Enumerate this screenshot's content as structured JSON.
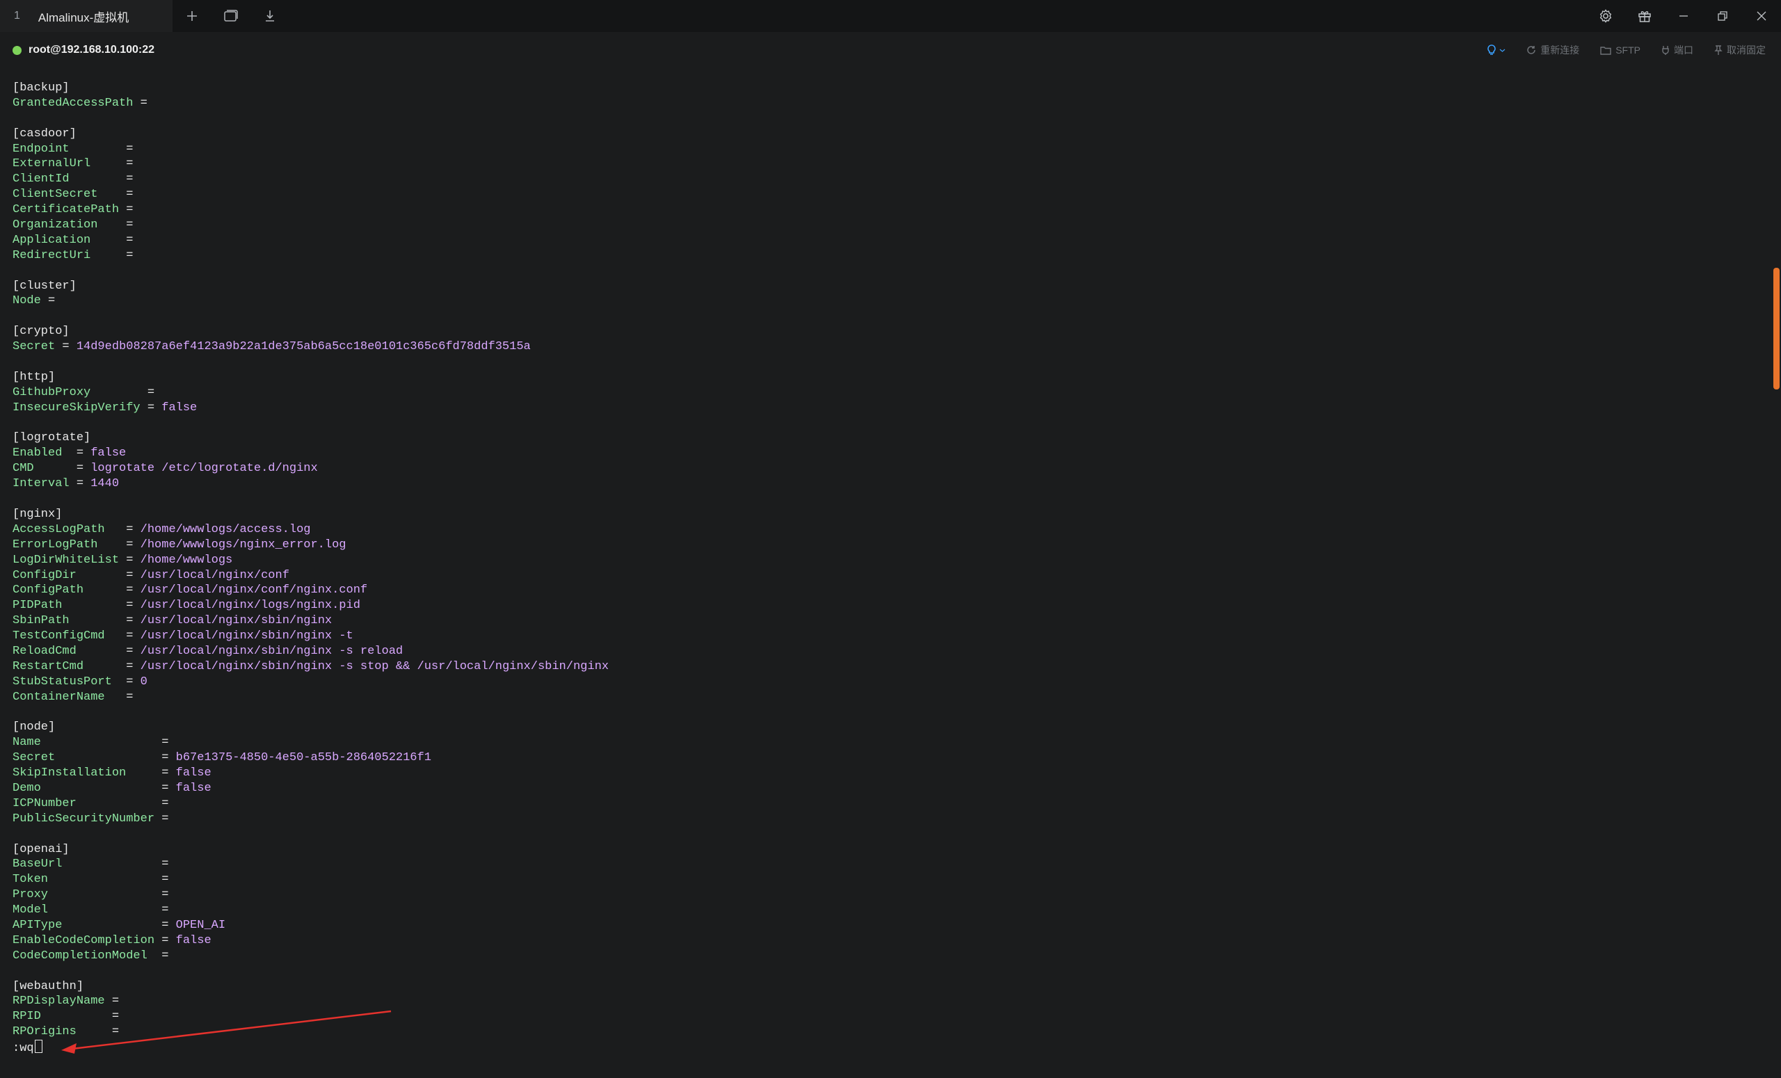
{
  "tab": {
    "index": "1",
    "title": "Almalinux-虚拟机"
  },
  "session": {
    "host": "root@192.168.10.100:22",
    "status_color": "#7ed35a",
    "actions": {
      "reconnect": "重新连接",
      "sftp": "SFTP",
      "port": "端口",
      "unpin": "取消固定"
    }
  },
  "icons": {
    "new_tab": "plus-icon",
    "clone_tab": "window-copy-icon",
    "download": "download-icon",
    "settings": "gear-icon",
    "gift": "gift-icon",
    "minimize": "minimize-icon",
    "restore": "restore-icon",
    "close": "close-icon",
    "bulb": "lightbulb-icon"
  },
  "colors": {
    "key": "#8fe7a2",
    "value": "#d9a8ff",
    "scroll_thumb": "#e9742b",
    "annotation_arrow": "#e5322d"
  },
  "terminal": {
    "lines": [
      {
        "t": "sec",
        "text": "[backup]"
      },
      {
        "t": "kv",
        "key": "GrantedAccessPath",
        "eq": " =",
        "val": ""
      },
      {
        "t": "blank"
      },
      {
        "t": "sec",
        "text": "[casdoor]"
      },
      {
        "t": "kv",
        "key": "Endpoint",
        "eq": "        =",
        "val": ""
      },
      {
        "t": "kv",
        "key": "ExternalUrl",
        "eq": "     =",
        "val": ""
      },
      {
        "t": "kv",
        "key": "ClientId",
        "eq": "        =",
        "val": ""
      },
      {
        "t": "kv",
        "key": "ClientSecret",
        "eq": "    =",
        "val": ""
      },
      {
        "t": "kv",
        "key": "CertificatePath",
        "eq": " =",
        "val": ""
      },
      {
        "t": "kv",
        "key": "Organization",
        "eq": "    =",
        "val": ""
      },
      {
        "t": "kv",
        "key": "Application",
        "eq": "     =",
        "val": ""
      },
      {
        "t": "kv",
        "key": "RedirectUri",
        "eq": "     =",
        "val": ""
      },
      {
        "t": "blank"
      },
      {
        "t": "sec",
        "text": "[cluster]"
      },
      {
        "t": "kv",
        "key": "Node",
        "eq": " =",
        "val": ""
      },
      {
        "t": "blank"
      },
      {
        "t": "sec",
        "text": "[crypto]"
      },
      {
        "t": "kv",
        "key": "Secret",
        "eq": " = ",
        "val": "14d9edb08287a6ef4123a9b22a1de375ab6a5cc18e0101c365c6fd78ddf3515a"
      },
      {
        "t": "blank"
      },
      {
        "t": "sec",
        "text": "[http]"
      },
      {
        "t": "kv",
        "key": "GithubProxy",
        "eq": "        =",
        "val": ""
      },
      {
        "t": "kv",
        "key": "InsecureSkipVerify",
        "eq": " = ",
        "val": "false"
      },
      {
        "t": "blank"
      },
      {
        "t": "sec",
        "text": "[logrotate]"
      },
      {
        "t": "kv",
        "key": "Enabled",
        "eq": "  = ",
        "val": "false"
      },
      {
        "t": "kv",
        "key": "CMD",
        "eq": "      = ",
        "val": "logrotate /etc/logrotate.d/nginx"
      },
      {
        "t": "kv",
        "key": "Interval",
        "eq": " = ",
        "val": "1440"
      },
      {
        "t": "blank"
      },
      {
        "t": "sec",
        "text": "[nginx]"
      },
      {
        "t": "kv",
        "key": "AccessLogPath",
        "eq": "   = ",
        "val": "/home/wwwlogs/access.log"
      },
      {
        "t": "kv",
        "key": "ErrorLogPath",
        "eq": "    = ",
        "val": "/home/wwwlogs/nginx_error.log"
      },
      {
        "t": "kv",
        "key": "LogDirWhiteList",
        "eq": " = ",
        "val": "/home/wwwlogs"
      },
      {
        "t": "kv",
        "key": "ConfigDir",
        "eq": "       = ",
        "val": "/usr/local/nginx/conf"
      },
      {
        "t": "kv",
        "key": "ConfigPath",
        "eq": "      = ",
        "val": "/usr/local/nginx/conf/nginx.conf"
      },
      {
        "t": "kv",
        "key": "PIDPath",
        "eq": "         = ",
        "val": "/usr/local/nginx/logs/nginx.pid"
      },
      {
        "t": "kv",
        "key": "SbinPath",
        "eq": "        = ",
        "val": "/usr/local/nginx/sbin/nginx"
      },
      {
        "t": "kv",
        "key": "TestConfigCmd",
        "eq": "   = ",
        "val": "/usr/local/nginx/sbin/nginx -t"
      },
      {
        "t": "kv",
        "key": "ReloadCmd",
        "eq": "       = ",
        "val": "/usr/local/nginx/sbin/nginx -s reload"
      },
      {
        "t": "kv",
        "key": "RestartCmd",
        "eq": "      = ",
        "val": "/usr/local/nginx/sbin/nginx -s stop && /usr/local/nginx/sbin/nginx"
      },
      {
        "t": "kv",
        "key": "StubStatusPort",
        "eq": "  = ",
        "val": "0"
      },
      {
        "t": "kv",
        "key": "ContainerName",
        "eq": "   =",
        "val": ""
      },
      {
        "t": "blank"
      },
      {
        "t": "sec",
        "text": "[node]"
      },
      {
        "t": "kv",
        "key": "Name",
        "eq": "                 =",
        "val": ""
      },
      {
        "t": "kv",
        "key": "Secret",
        "eq": "               = ",
        "val": "b67e1375-4850-4e50-a55b-2864052216f1"
      },
      {
        "t": "kv",
        "key": "SkipInstallation",
        "eq": "     = ",
        "val": "false"
      },
      {
        "t": "kv",
        "key": "Demo",
        "eq": "                 = ",
        "val": "false"
      },
      {
        "t": "kv",
        "key": "ICPNumber",
        "eq": "            =",
        "val": ""
      },
      {
        "t": "kv",
        "key": "PublicSecurityNumber",
        "eq": " =",
        "val": ""
      },
      {
        "t": "blank"
      },
      {
        "t": "sec",
        "text": "[openai]"
      },
      {
        "t": "kv",
        "key": "BaseUrl",
        "eq": "              =",
        "val": ""
      },
      {
        "t": "kv",
        "key": "Token",
        "eq": "                =",
        "val": ""
      },
      {
        "t": "kv",
        "key": "Proxy",
        "eq": "                =",
        "val": ""
      },
      {
        "t": "kv",
        "key": "Model",
        "eq": "                =",
        "val": ""
      },
      {
        "t": "kv",
        "key": "APIType",
        "eq": "              = ",
        "val": "OPEN_AI"
      },
      {
        "t": "kv",
        "key": "EnableCodeCompletion",
        "eq": " = ",
        "val": "false"
      },
      {
        "t": "kv",
        "key": "CodeCompletionModel",
        "eq": "  =",
        "val": ""
      },
      {
        "t": "blank"
      },
      {
        "t": "sec",
        "text": "[webauthn]"
      },
      {
        "t": "kv",
        "key": "RPDisplayName",
        "eq": " =",
        "val": ""
      },
      {
        "t": "kv",
        "key": "RPID",
        "eq": "          =",
        "val": ""
      },
      {
        "t": "kv",
        "key": "RPOrigins",
        "eq": "     =",
        "val": ""
      },
      {
        "t": "cmd",
        "text": ":wq"
      }
    ]
  }
}
